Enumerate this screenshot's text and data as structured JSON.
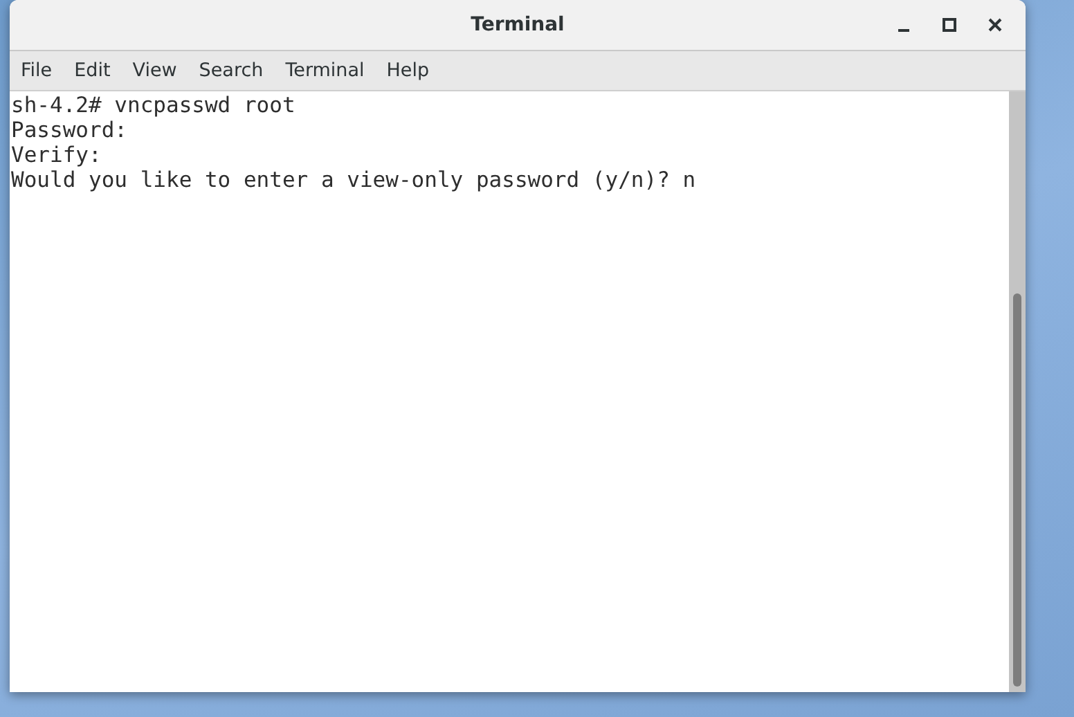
{
  "window": {
    "title": "Terminal"
  },
  "menu": [
    "File",
    "Edit",
    "View",
    "Search",
    "Terminal",
    "Help"
  ],
  "terminal": {
    "lines": [
      "sh-4.2# vncpasswd root",
      "Password:",
      "Verify:",
      "Would you like to enter a view-only password (y/n)? n"
    ]
  }
}
